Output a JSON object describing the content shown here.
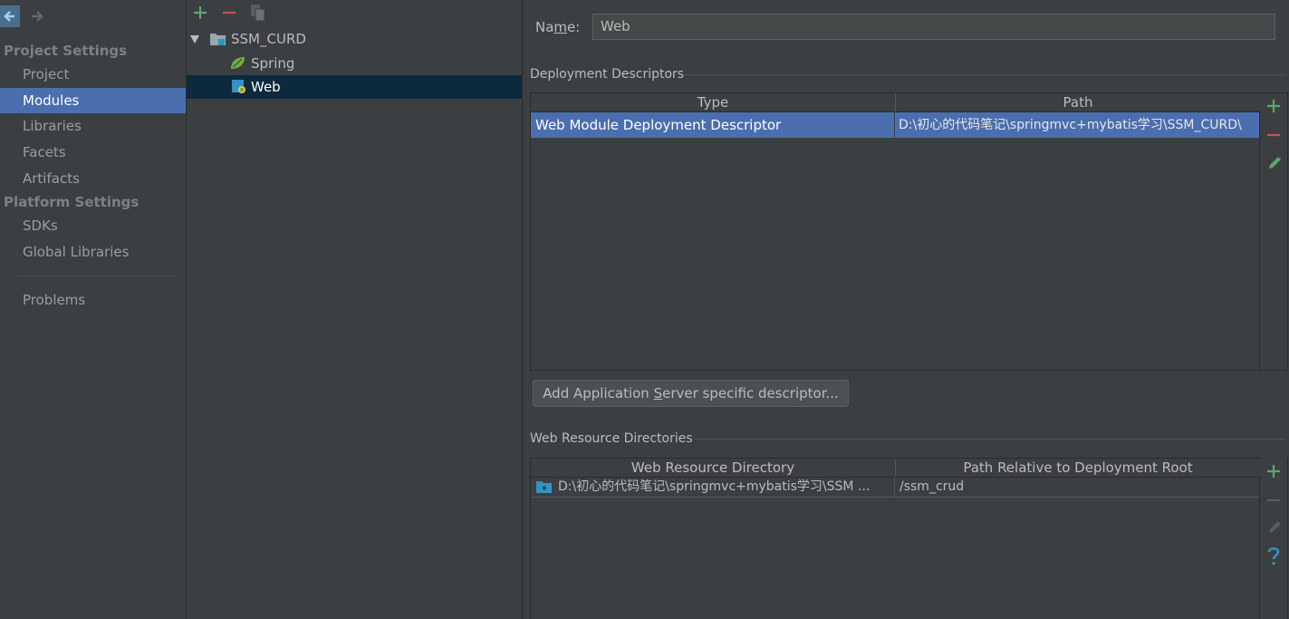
{
  "nav": {
    "sections": [
      {
        "title": "Project Settings",
        "items": [
          "Project",
          "Modules",
          "Libraries",
          "Facets",
          "Artifacts"
        ]
      },
      {
        "title": "Platform Settings",
        "items": [
          "SDKs",
          "Global Libraries"
        ]
      }
    ],
    "problems": "Problems",
    "selected": "Modules"
  },
  "tree": {
    "root": "SSM_CURD",
    "children": [
      "Spring",
      "Web"
    ],
    "selected": "Web"
  },
  "name_field": {
    "label_pre": "Na",
    "label_mn": "m",
    "label_post": "e:",
    "value": "Web"
  },
  "deployment": {
    "title": "Deployment Descriptors",
    "columns": [
      "Type",
      "Path"
    ],
    "rows": [
      {
        "type": "Web Module Deployment Descriptor",
        "path": "D:\\初心的代码笔记\\springmvc+mybatis学习\\SSM_CURD\\"
      }
    ],
    "add_button": {
      "pre": "Add Application ",
      "mn": "S",
      "post": "erver specific descriptor..."
    }
  },
  "web_resources": {
    "title": "Web Resource Directories",
    "columns": [
      "Web Resource Directory",
      "Path Relative to Deployment Root"
    ],
    "rows": [
      {
        "dir": "D:\\初心的代码笔记\\springmvc+mybatis学习\\SSM ...",
        "rel": "/ssm_crud"
      }
    ]
  },
  "colors": {
    "accent_green": "#59a869",
    "accent_red": "#c75450",
    "selection": "#4b6eaf",
    "tree_selection": "#0d293e",
    "help_blue": "#3592c4"
  }
}
